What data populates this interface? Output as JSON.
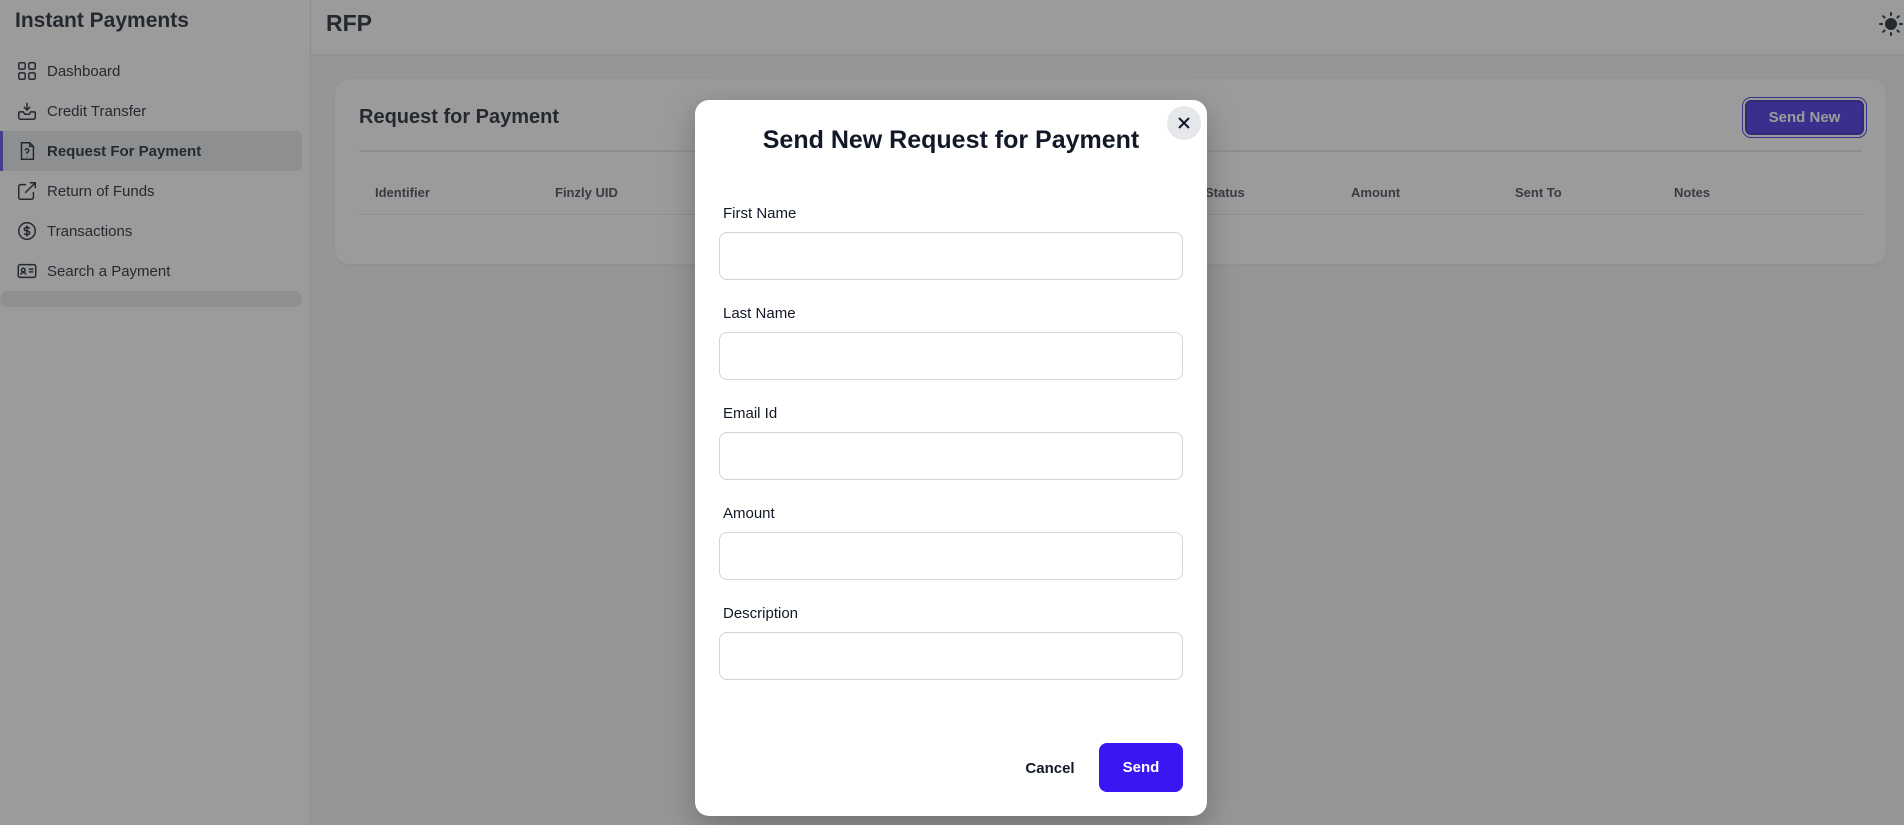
{
  "sidebar": {
    "app_title": "Instant Payments",
    "items": [
      {
        "label": "Dashboard",
        "icon": "dashboard-grid-icon",
        "active": false
      },
      {
        "label": "Credit Transfer",
        "icon": "inbox-tray-icon",
        "active": false
      },
      {
        "label": "Request For Payment",
        "icon": "document-request-icon",
        "active": true
      },
      {
        "label": "Return of Funds",
        "icon": "external-link-icon",
        "active": false
      },
      {
        "label": "Transactions",
        "icon": "dollar-circle-icon",
        "active": false
      },
      {
        "label": "Search a Payment",
        "icon": "id-card-icon",
        "active": false
      }
    ]
  },
  "header": {
    "page_title": "RFP",
    "theme_icon": "sun-icon"
  },
  "card": {
    "title": "Request for Payment",
    "send_new_label": "Send New",
    "columns": [
      "Identifier",
      "Finzly UID",
      "Status",
      "Amount",
      "Sent To",
      "Notes"
    ]
  },
  "modal": {
    "title": "Send New Request for Payment",
    "close_icon": "close-icon",
    "fields": [
      {
        "label": "First Name",
        "value": "",
        "placeholder": ""
      },
      {
        "label": "Last Name",
        "value": "",
        "placeholder": ""
      },
      {
        "label": "Email Id",
        "value": "",
        "placeholder": ""
      },
      {
        "label": "Amount",
        "value": "",
        "placeholder": ""
      },
      {
        "label": "Description",
        "value": "",
        "placeholder": ""
      }
    ],
    "cancel_label": "Cancel",
    "send_label": "Send"
  },
  "colors": {
    "accent": "#3b16f2",
    "overlay": "#373737",
    "active_nav_bg": "#e5e7eb"
  }
}
